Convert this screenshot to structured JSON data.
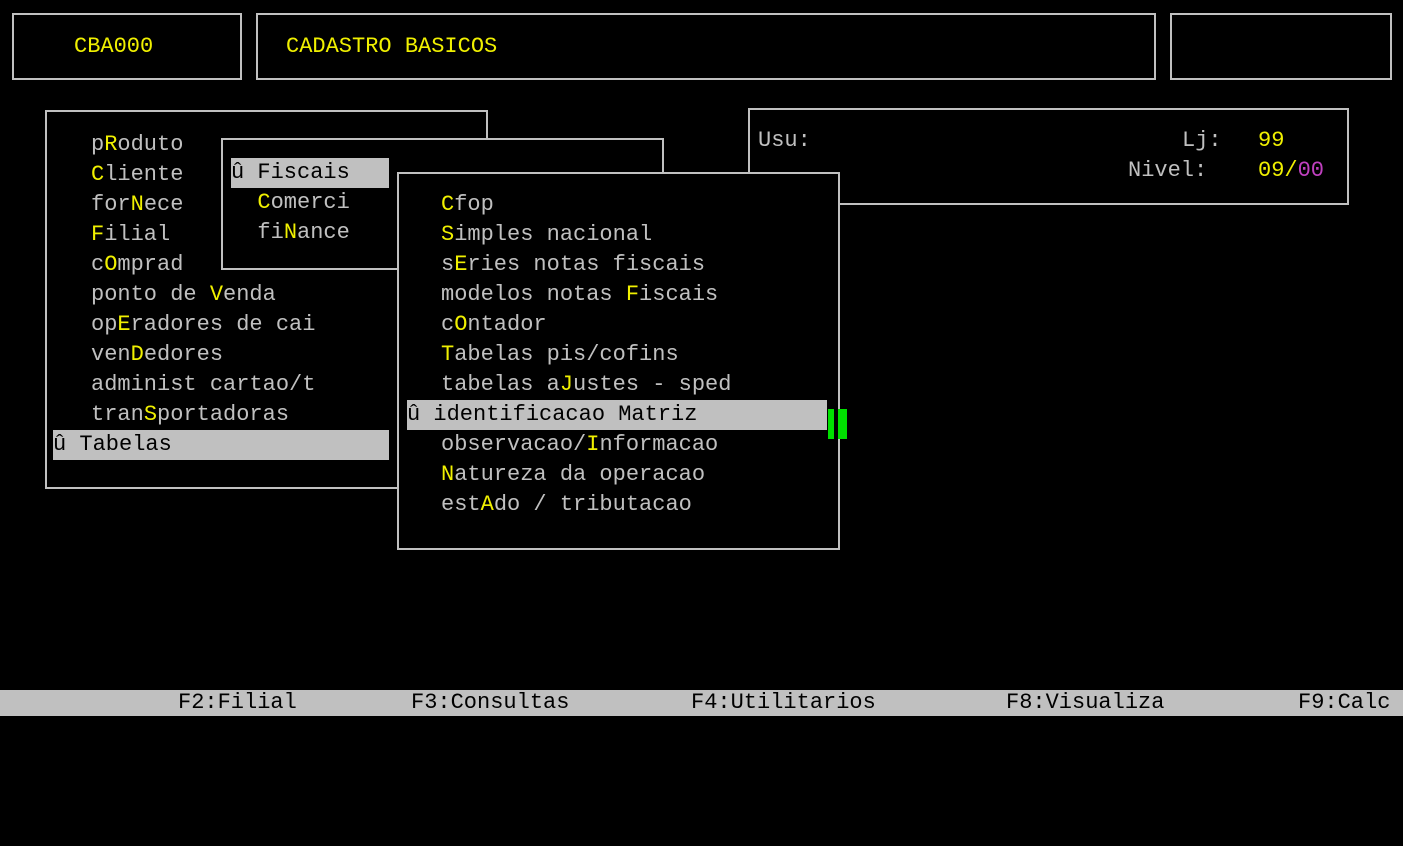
{
  "header": {
    "code": "CBA000",
    "title": "CADASTRO BASICOS",
    "right": ""
  },
  "info": {
    "usu_label": "Usu:",
    "lj_label": "Lj:",
    "lj_value": "99",
    "nivel_label": "Nivel:",
    "nivel_value_a": "09/",
    "nivel_value_b": "00"
  },
  "main_menu": {
    "items": [
      {
        "pre": "p",
        "hot": "R",
        "post": "oduto"
      },
      {
        "pre": "",
        "hot": "C",
        "post": "liente"
      },
      {
        "pre": "for",
        "hot": "N",
        "post": "ece"
      },
      {
        "pre": "",
        "hot": "F",
        "post": "ilial"
      },
      {
        "pre": "c",
        "hot": "O",
        "post": "mprad"
      },
      {
        "pre": "ponto de ",
        "hot": "V",
        "post": "enda"
      },
      {
        "pre": "op",
        "hot": "E",
        "post": "radores de cai"
      },
      {
        "pre": "ven",
        "hot": "D",
        "post": "edores"
      },
      {
        "pre": "administ cartao/t",
        "hot": "",
        "post": ""
      },
      {
        "pre": "tran",
        "hot": "S",
        "post": "portadoras"
      },
      {
        "pre": "û Tabelas",
        "hot": "",
        "post": ""
      }
    ]
  },
  "sub_menu": {
    "items": [
      {
        "pre": "û Fiscais",
        "hot": "",
        "post": ""
      },
      {
        "pre": "  ",
        "hot": "C",
        "post": "omerci"
      },
      {
        "pre": "  fi",
        "hot": "N",
        "post": "ance"
      }
    ]
  },
  "fiscal_menu": {
    "items": [
      {
        "pre": "",
        "hot": "C",
        "post": "fop"
      },
      {
        "pre": "",
        "hot": "S",
        "post": "imples nacional"
      },
      {
        "pre": "s",
        "hot": "E",
        "post": "ries notas fiscais"
      },
      {
        "pre": "modelos notas ",
        "hot": "F",
        "post": "iscais"
      },
      {
        "pre": "c",
        "hot": "O",
        "post": "ntador"
      },
      {
        "pre": "",
        "hot": "T",
        "post": "abelas pis/cofins"
      },
      {
        "pre": "tabelas a",
        "hot": "J",
        "post": "ustes - sped"
      },
      {
        "pre": "û identificacao Matriz",
        "hot": "",
        "post": ""
      },
      {
        "pre": "observacao/",
        "hot": "I",
        "post": "nformacao"
      },
      {
        "pre": "",
        "hot": "N",
        "post": "atureza da operacao"
      },
      {
        "pre": "est",
        "hot": "A",
        "post": "do / tributacao"
      }
    ]
  },
  "statusbar": {
    "f2": "F2:Filial",
    "f3": "F3:Consultas",
    "f4": "F4:Utilitarios",
    "f8": "F8:Visualiza",
    "f9": "F9:Calc"
  }
}
